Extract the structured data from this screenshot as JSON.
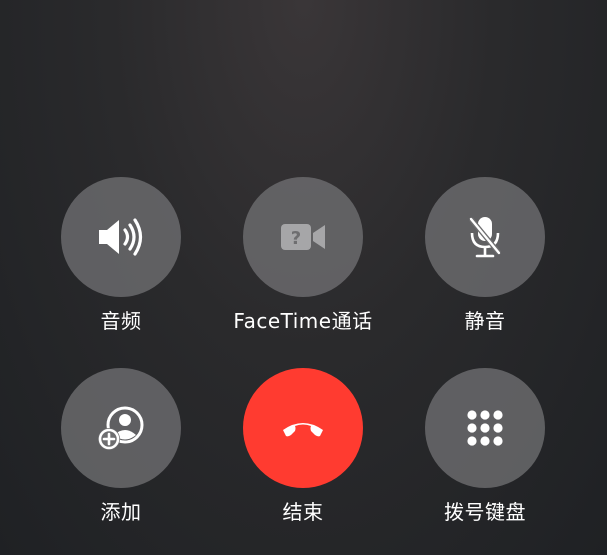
{
  "buttons": {
    "audio": {
      "label": "音频",
      "icon": "speaker-icon"
    },
    "facetime": {
      "label": "FaceTime通话",
      "icon": "facetime-video-icon",
      "icon_glyph": "?"
    },
    "mute": {
      "label": "静音",
      "icon": "microphone-slash-icon"
    },
    "add": {
      "label": "添加",
      "icon": "add-contact-icon"
    },
    "end": {
      "label": "结束",
      "icon": "phone-hangup-icon",
      "color": "#ff3b30"
    },
    "keypad": {
      "label": "拨号键盘",
      "icon": "keypad-grid-icon"
    }
  }
}
